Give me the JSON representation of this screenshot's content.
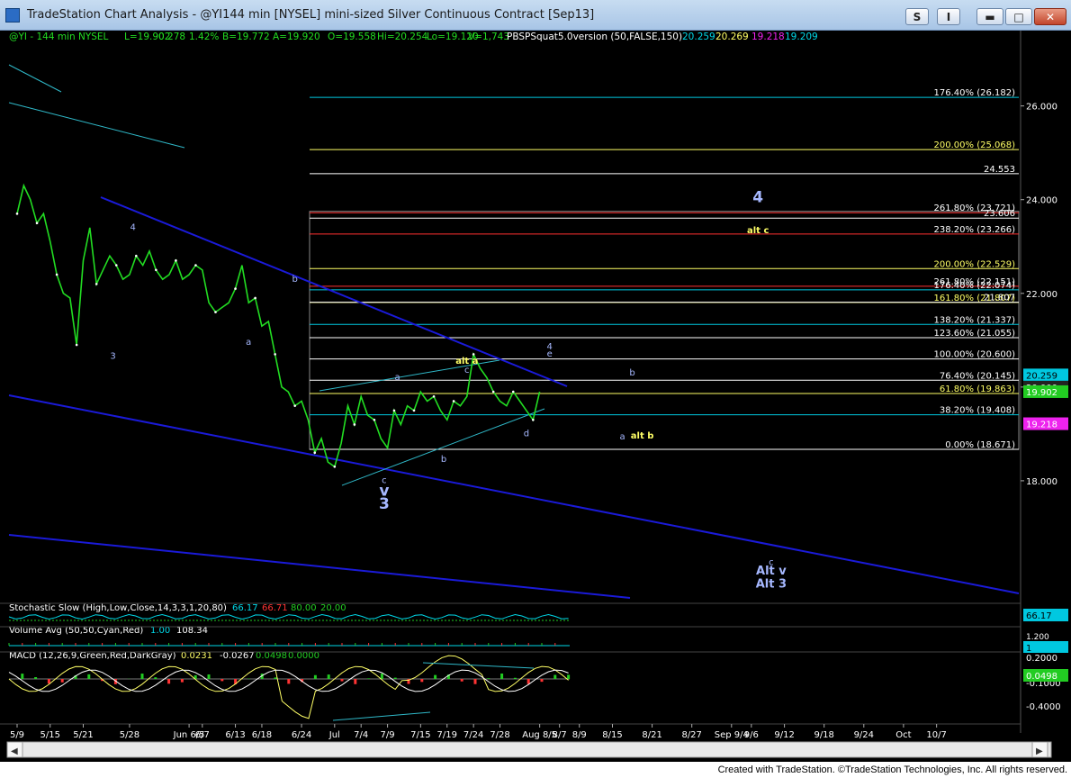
{
  "window": {
    "title": "TradeStation Chart Analysis - @YI144 min [NYSEL] mini-sized Silver Continuous Contract [Sep13]",
    "btn_s": "S",
    "btn_i": "I",
    "btn_min": "▬",
    "btn_max": "□",
    "btn_close": "✕"
  },
  "header": {
    "symbol": "@YI - 144 min  NYSEL",
    "last": "L=19.902",
    "change": "0.278",
    "change_pct": "1.42%",
    "bid": "B=19.772",
    "ask": "A=19.920",
    "open": "O=19.558",
    "high": "Hi=20.254",
    "low": "Lo=19.120",
    "volume": "V=1,743",
    "study": "PBSPSquat5.0version (50,FALSE,150)",
    "s1": "20.259",
    "s2": "20.269",
    "s3": "19.218",
    "s4": "19.209"
  },
  "chart_data": {
    "type": "line",
    "title": "",
    "xlabel": "",
    "ylabel": "",
    "ylim": [
      15.5,
      27.3
    ],
    "y_ticks": [
      "26.000",
      "24.000",
      "22.000",
      "20.000",
      "18.000"
    ],
    "y_tick_values": [
      26,
      24,
      22,
      20,
      18
    ],
    "x_ticks": [
      "5/9",
      "5/15",
      "5/21",
      "5/28",
      "Jun 6/5",
      "6/7",
      "6/13",
      "6/18",
      "6/24",
      "Jul",
      "7/4",
      "7/9",
      "7/15",
      "7/19",
      "7/24",
      "7/28",
      "Aug 8/5",
      "8/7",
      "8/9",
      "8/15",
      "8/21",
      "8/27",
      "Sep 9/4",
      "9/6",
      "9/12",
      "9/18",
      "9/24",
      "Oct",
      "10/7"
    ],
    "x_tick_index": [
      0,
      5,
      10,
      17,
      26,
      28,
      33,
      37,
      43,
      48,
      52,
      56,
      61,
      65,
      69,
      73,
      79,
      82,
      85,
      90,
      96,
      102,
      108,
      111,
      116,
      122,
      128,
      134,
      139
    ],
    "series": [
      {
        "name": "",
        "x": [
          0,
          1,
          2,
          3,
          4,
          5,
          6,
          7,
          8,
          9,
          10,
          11,
          12,
          13,
          14,
          15,
          16,
          17,
          18,
          19,
          20,
          21,
          22,
          23,
          24,
          25,
          26,
          27,
          28,
          29,
          30,
          31,
          32,
          33,
          34,
          35,
          36,
          37,
          38,
          39,
          40,
          41,
          42,
          43,
          44,
          45,
          46,
          47,
          48,
          49,
          50,
          51,
          52,
          53,
          54,
          55,
          56,
          57,
          58,
          59,
          60,
          61,
          62,
          63,
          64,
          65,
          66,
          67,
          68,
          69,
          70,
          71,
          72,
          73,
          74,
          75,
          76,
          77,
          78,
          79
        ],
        "values": [
          23.7,
          24.3,
          24.0,
          23.5,
          23.7,
          23.1,
          22.4,
          22.0,
          21.9,
          20.9,
          22.7,
          23.4,
          22.2,
          22.5,
          22.8,
          22.6,
          22.3,
          22.4,
          22.8,
          22.6,
          22.9,
          22.5,
          22.3,
          22.4,
          22.7,
          22.3,
          22.4,
          22.6,
          22.5,
          21.8,
          21.6,
          21.7,
          21.8,
          22.1,
          22.6,
          21.8,
          21.9,
          21.3,
          21.4,
          20.7,
          20.0,
          19.9,
          19.6,
          19.7,
          19.3,
          18.6,
          18.9,
          18.4,
          18.3,
          18.8,
          19.6,
          19.2,
          19.8,
          19.4,
          19.3,
          18.9,
          18.7,
          19.5,
          19.2,
          19.6,
          19.5,
          19.9,
          19.7,
          19.8,
          19.5,
          19.3,
          19.7,
          19.6,
          19.8,
          20.7,
          20.4,
          20.2,
          19.9,
          19.7,
          19.6,
          19.9,
          19.7,
          19.5,
          19.3,
          19.9
        ]
      }
    ],
    "fib_levels": [
      {
        "label": "176.40% (26.182)",
        "value": 26.182
      },
      {
        "label": "200.00% (25.068)",
        "value": 25.068
      },
      {
        "label": "24.553",
        "value": 24.553
      },
      {
        "label": "261.80% (23.721)",
        "value": 23.721
      },
      {
        "label": "23.606",
        "value": 23.606
      },
      {
        "label": "238.20% (23.266)",
        "value": 23.266
      },
      {
        "label": "200.00% (22.529)",
        "value": 22.529
      },
      {
        "label": "261.80% (22.151)",
        "value": 22.151
      },
      {
        "label": "176.40% (22.074)",
        "value": 22.074
      },
      {
        "label": "161.80% (21.807)",
        "value": 21.807
      },
      {
        "label": "21.807",
        "value": 21.81
      },
      {
        "label": "138.20% (21.337)",
        "value": 21.337
      },
      {
        "label": "123.60% (21.055)",
        "value": 21.055
      },
      {
        "label": "100.00% (20.600)",
        "value": 20.6
      },
      {
        "label": "76.40% (20.145)",
        "value": 20.145
      },
      {
        "label": "61.80% (19.863)",
        "value": 19.863
      },
      {
        "label": "38.20% (19.408)",
        "value": 19.408
      },
      {
        "label": "0.00% (18.671)",
        "value": 18.671
      }
    ],
    "price_badges": [
      {
        "text": "20.259",
        "value": 20.259
      },
      {
        "text": "20.000",
        "value": 20.0
      },
      {
        "text": "19.902",
        "value": 19.902
      },
      {
        "text": "19.218",
        "value": 19.218
      }
    ],
    "wave_labels": [
      {
        "text": "4",
        "x": 17.5,
        "y": 23.35
      },
      {
        "text": "3",
        "x": 14.5,
        "y": 20.6
      },
      {
        "text": "b",
        "x": 42,
        "y": 22.25
      },
      {
        "text": "a",
        "x": 35,
        "y": 20.9
      },
      {
        "text": "alt a",
        "x": 68,
        "y": 20.5
      },
      {
        "text": "a",
        "x": 57.5,
        "y": 20.15
      },
      {
        "text": "c",
        "x": 68,
        "y": 20.3
      },
      {
        "text": "4",
        "x": 80.5,
        "y": 20.8
      },
      {
        "text": "e",
        "x": 80.5,
        "y": 20.65
      },
      {
        "text": "b",
        "x": 93,
        "y": 20.25
      },
      {
        "text": "d",
        "x": 77,
        "y": 18.95
      },
      {
        "text": "b",
        "x": 64.5,
        "y": 18.4
      },
      {
        "text": "c",
        "x": 55.5,
        "y": 17.95
      },
      {
        "text": "v",
        "x": 55.5,
        "y": 17.68
      },
      {
        "text": "3",
        "x": 55.5,
        "y": 17.4
      },
      {
        "text": "a",
        "x": 91.5,
        "y": 18.88
      },
      {
        "text": "alt b",
        "x": 94.5,
        "y": 18.9
      },
      {
        "text": "4",
        "x": 112,
        "y": 23.95
      },
      {
        "text": "alt c",
        "x": 112,
        "y": 23.28
      },
      {
        "text": "c",
        "x": 114,
        "y": 16.2
      },
      {
        "text": "Alt v",
        "x": 114,
        "y": 16.0
      },
      {
        "text": "Alt 3",
        "x": 114,
        "y": 15.72
      }
    ],
    "stochastic": {
      "label": "Stochastic Slow (High,Low,Close,14,3,3,1,20,80)",
      "values": [
        "66.17",
        "66.71",
        "80.00",
        "20.00"
      ],
      "badge": "66.17"
    },
    "volume": {
      "label": "Volume Avg (50,50,Cyan,Red)",
      "values": [
        "1.00",
        "108.34"
      ],
      "badge": "1",
      "ticks": [
        "1.200"
      ]
    },
    "macd": {
      "label": "MACD (12,26,9,Green,Red,DarkGray)",
      "values": [
        "0.0231",
        "-0.0267",
        "0.0498",
        "0.0000"
      ],
      "ticks": [
        "0.2000",
        "0.0498",
        "-0.1000",
        "-0.4000"
      ],
      "badge": "0.0498"
    },
    "grid": false,
    "legend": "top-left"
  },
  "colors": {
    "background": "#000000",
    "price": "#22dd22",
    "channel": "#1a1ad8",
    "fib": "#ffffff",
    "fib_text_yellow": "#ffff66",
    "badge_cyan": "#00c8e0",
    "badge_green": "#22cc22",
    "badge_magenta": "#ee22ee",
    "label_blue": "#a6b8ff"
  },
  "footer": "Created with TradeStation. ©TradeStation Technologies, Inc. All rights reserved."
}
